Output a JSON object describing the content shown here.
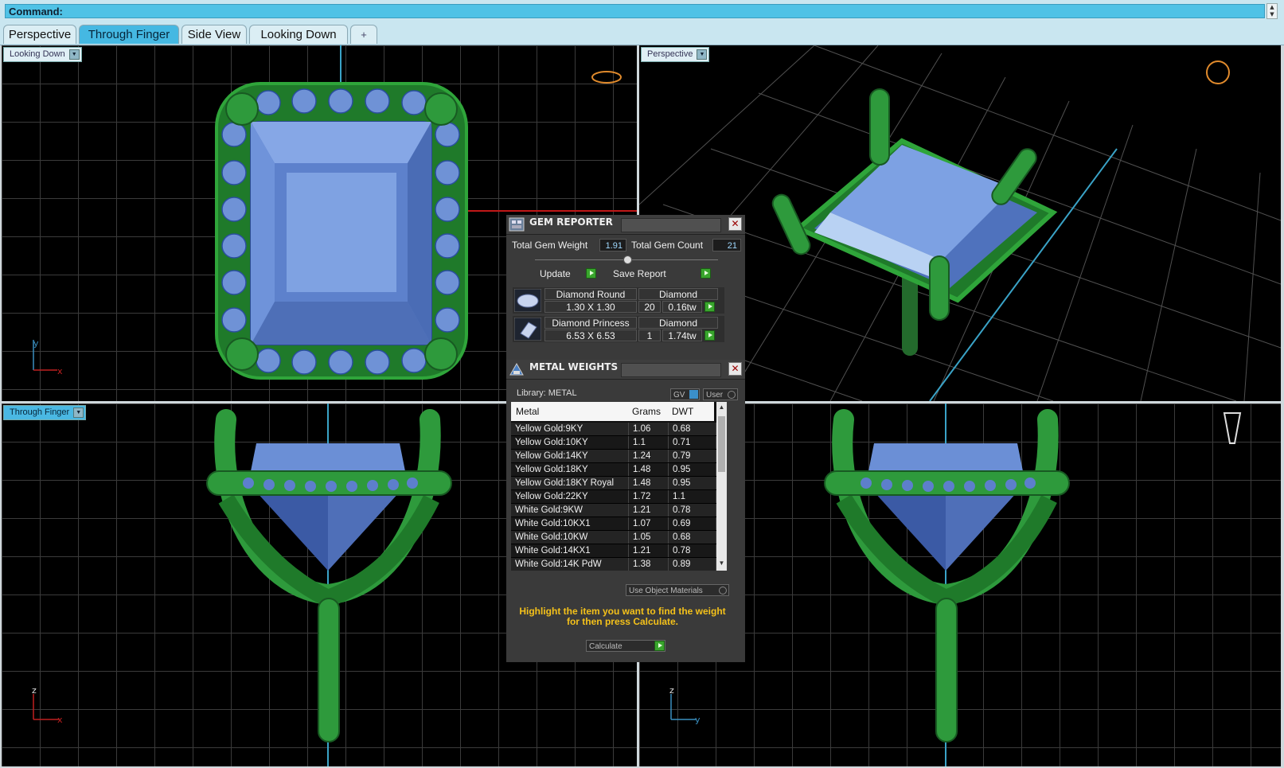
{
  "command": {
    "label": "Command:"
  },
  "tabs": [
    {
      "label": "Perspective"
    },
    {
      "label": "Through Finger",
      "active": true
    },
    {
      "label": "Side View"
    },
    {
      "label": "Looking Down"
    },
    {
      "label": "+"
    }
  ],
  "viewports": {
    "top_left": {
      "label": "Looking Down"
    },
    "top_right": {
      "label": "Perspective"
    },
    "bottom_left": {
      "label": "Through Finger"
    },
    "axes": {
      "x": "x",
      "y": "y",
      "z": "z"
    }
  },
  "gem_reporter": {
    "title": "GEM REPORTER",
    "total_weight_label": "Total Gem Weight",
    "total_weight": "1.91",
    "total_count_label": "Total Gem Count",
    "total_count": "21",
    "update_label": "Update",
    "save_label": "Save Report",
    "gems": [
      {
        "name": "Diamond Round",
        "material": "Diamond",
        "size": "1.30 X 1.30",
        "count": "20",
        "weight": "0.16tw"
      },
      {
        "name": "Diamond Princess",
        "material": "Diamond",
        "size": "6.53 X 6.53",
        "count": "1",
        "weight": "1.74tw"
      }
    ]
  },
  "metal_weights": {
    "title": "METAL WEIGHTS",
    "library": "Library: METAL",
    "gv_label": "GV",
    "user_label": "User",
    "columns": [
      "Metal",
      "Grams",
      "DWT"
    ],
    "rows": [
      {
        "metal": "Yellow Gold:9KY",
        "grams": "1.06",
        "dwt": "0.68"
      },
      {
        "metal": "Yellow Gold:10KY",
        "grams": "1.1",
        "dwt": "0.71"
      },
      {
        "metal": "Yellow Gold:14KY",
        "grams": "1.24",
        "dwt": "0.79"
      },
      {
        "metal": "Yellow Gold:18KY",
        "grams": "1.48",
        "dwt": "0.95"
      },
      {
        "metal": "Yellow Gold:18KY Royal",
        "grams": "1.48",
        "dwt": "0.95"
      },
      {
        "metal": "Yellow Gold:22KY",
        "grams": "1.72",
        "dwt": "1.1"
      },
      {
        "metal": "White Gold:9KW",
        "grams": "1.21",
        "dwt": "0.78"
      },
      {
        "metal": "White Gold:10KX1",
        "grams": "1.07",
        "dwt": "0.69"
      },
      {
        "metal": "White Gold:10KW",
        "grams": "1.05",
        "dwt": "0.68"
      },
      {
        "metal": "White Gold:14KX1",
        "grams": "1.21",
        "dwt": "0.78"
      },
      {
        "metal": "White Gold:14K PdW",
        "grams": "1.38",
        "dwt": "0.89"
      }
    ],
    "use_object_materials": "Use Object Materials",
    "hint_line1": "Highlight the item you want to find the weight",
    "hint_line2": "for then press Calculate.",
    "calculate_label": "Calculate"
  }
}
